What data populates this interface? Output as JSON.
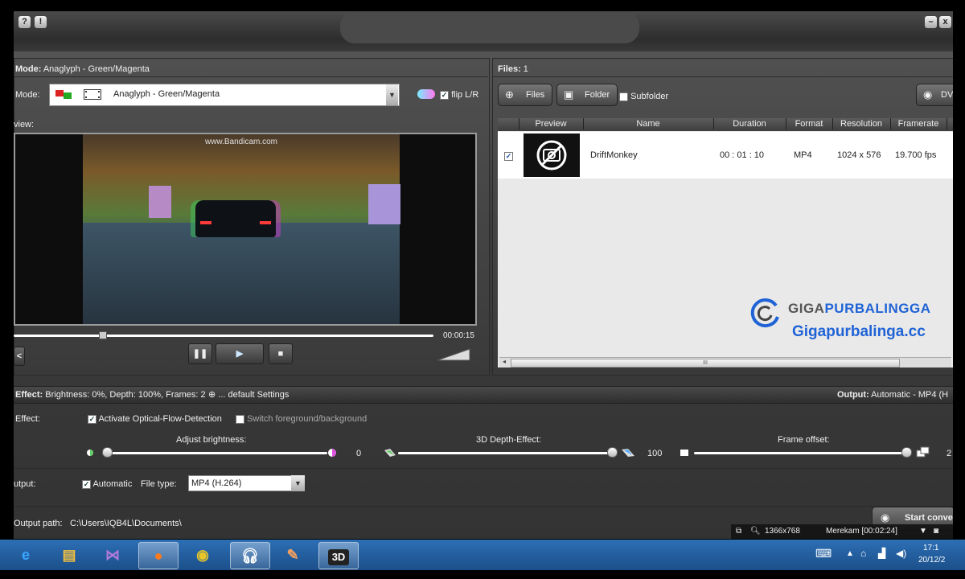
{
  "titlebar": {
    "help": "?",
    "info": "!",
    "minimize": "–",
    "close": "x"
  },
  "mode": {
    "header_label": "Mode:",
    "header_value": "Anaglyph - Green/Magenta",
    "label": "Mode:",
    "selected": "Anaglyph - Green/Magenta",
    "flip_label": "flip L/R",
    "preview_label": "view:"
  },
  "video": {
    "watermark": "www.Bandicam.com",
    "time": "00:00:15"
  },
  "files": {
    "header_label": "Files:",
    "count": "1",
    "files_button": "Files",
    "folder_button": "Folder",
    "subfolder_label": "Subfolder",
    "dvd_button": "DV",
    "columns": [
      "Preview",
      "Name",
      "Duration",
      "Format",
      "Resolution",
      "Framerate"
    ],
    "rows": [
      {
        "name": "DriftMonkey",
        "duration": "00 : 01 : 10",
        "format": "MP4",
        "resolution": "1024 x 576",
        "framerate": "19.700 fps"
      }
    ],
    "scroll_grip": "III"
  },
  "watermark_brand": {
    "name_part1": "GIGA",
    "name_part2": "PURBALINGGA",
    "url": "Gigapurbalinga.cc"
  },
  "effect_bar": {
    "label": "Effect:",
    "value": "Brightness: 0%, Depth: 100%, Frames: 2",
    "default_link": "... default Settings",
    "output_label": "Output:",
    "output_value": "Automatic - MP4 (H"
  },
  "effect": {
    "label": "Effect:",
    "optical_flow": "Activate Optical-Flow-Detection",
    "switch_fg": "Switch foreground/background",
    "brightness_label": "Adjust brightness:",
    "brightness_value": "0",
    "depth_label": "3D Depth-Effect:",
    "depth_value": "100",
    "offset_label": "Frame offset:",
    "offset_value": "2",
    "brightness_level": 0.0,
    "depth_level": 1.0,
    "offset_level": 1.0
  },
  "output": {
    "label": "utput:",
    "automatic": "Automatic",
    "file_type_label": "File type:",
    "file_type": "MP4 (H.264)",
    "path_label": "Output path:",
    "path": "C:\\Users\\IQB4L\\Documents\\",
    "start_button": "Start conver"
  },
  "recorder": {
    "resolution": "1366x768",
    "status": "Merekam [00:02:24]"
  },
  "taskbar": {
    "app_3d": "3D",
    "time": "17:1",
    "date": "20/12/2"
  },
  "colors": {
    "brand_blue": "#1f63d6",
    "taskbar": "#2a66ad"
  }
}
